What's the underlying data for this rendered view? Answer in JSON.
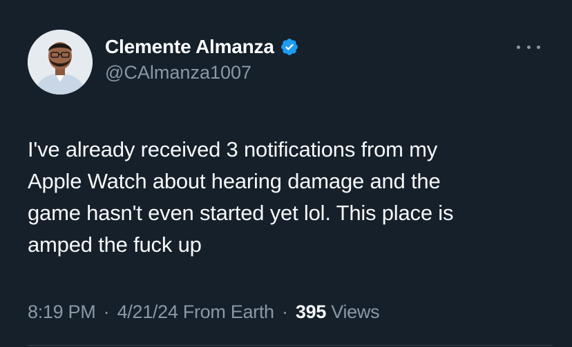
{
  "author": {
    "display_name": "Clemente Almanza",
    "handle": "@CAlmanza1007",
    "verified": true
  },
  "tweet": {
    "text": "I've already received 3 notifications from my\nApple Watch about hearing damage and the\ngame hasn't even started yet lol. This place is\namped the fuck up",
    "time": "8:19 PM",
    "separator": "·",
    "date": "4/21/24",
    "source": "From Earth",
    "views_count": "395",
    "views_label": "Views"
  },
  "icons": {
    "verified": "verified-badge-icon",
    "more": "more-options-icon"
  },
  "colors": {
    "background": "#15202b",
    "primary_text": "#f7f9f9",
    "secondary_text": "#8b98a5",
    "verified_blue": "#1d9bf0",
    "divider": "#38444d"
  }
}
